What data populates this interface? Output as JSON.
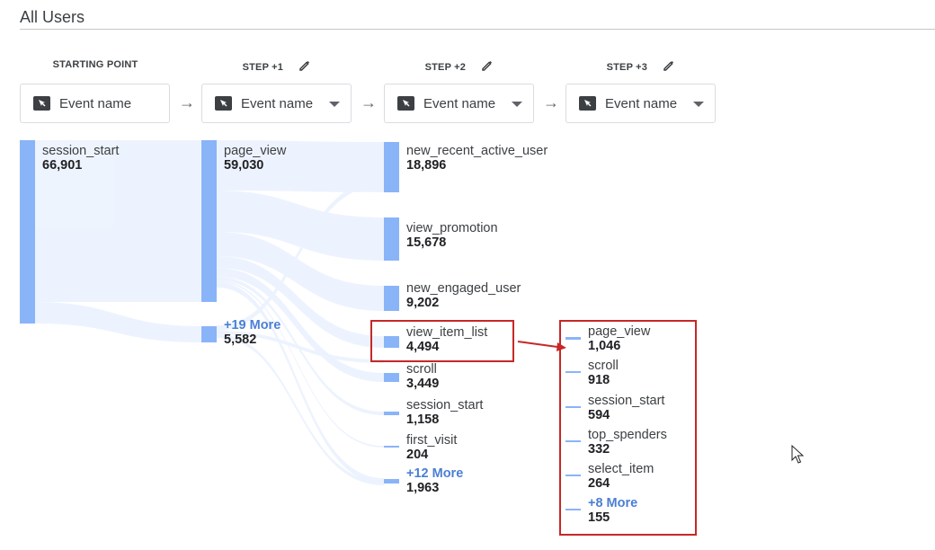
{
  "title": "All Users",
  "steps": [
    {
      "label": "STARTING POINT",
      "selector": "Event name"
    },
    {
      "label": "STEP +1",
      "selector": "Event name"
    },
    {
      "label": "STEP +2",
      "selector": "Event name"
    },
    {
      "label": "STEP +3",
      "selector": "Event name"
    }
  ],
  "colors": {
    "bar": "#8ab4f8",
    "highlight": "#c62828",
    "more_link": "#4a7fd4"
  },
  "step0": {
    "nodes": [
      {
        "name": "session_start",
        "value": "66,901"
      }
    ]
  },
  "step1": {
    "nodes": [
      {
        "name": "page_view",
        "value": "59,030"
      },
      {
        "name": "+19 More",
        "value": "5,582"
      }
    ]
  },
  "step2": {
    "nodes": [
      {
        "name": "new_recent_active_user",
        "value": "18,896"
      },
      {
        "name": "view_promotion",
        "value": "15,678"
      },
      {
        "name": "new_engaged_user",
        "value": "9,202"
      },
      {
        "name": "view_item_list",
        "value": "4,494"
      },
      {
        "name": "scroll",
        "value": "3,449"
      },
      {
        "name": "session_start",
        "value": "1,158"
      },
      {
        "name": "first_visit",
        "value": "204"
      },
      {
        "name": "+12 More",
        "value": "1,963"
      }
    ]
  },
  "step3": {
    "nodes": [
      {
        "name": "page_view",
        "value": "1,046"
      },
      {
        "name": "scroll",
        "value": "918"
      },
      {
        "name": "session_start",
        "value": "594"
      },
      {
        "name": "top_spenders",
        "value": "332"
      },
      {
        "name": "select_item",
        "value": "264"
      },
      {
        "name": "+8 More",
        "value": "155"
      }
    ]
  }
}
